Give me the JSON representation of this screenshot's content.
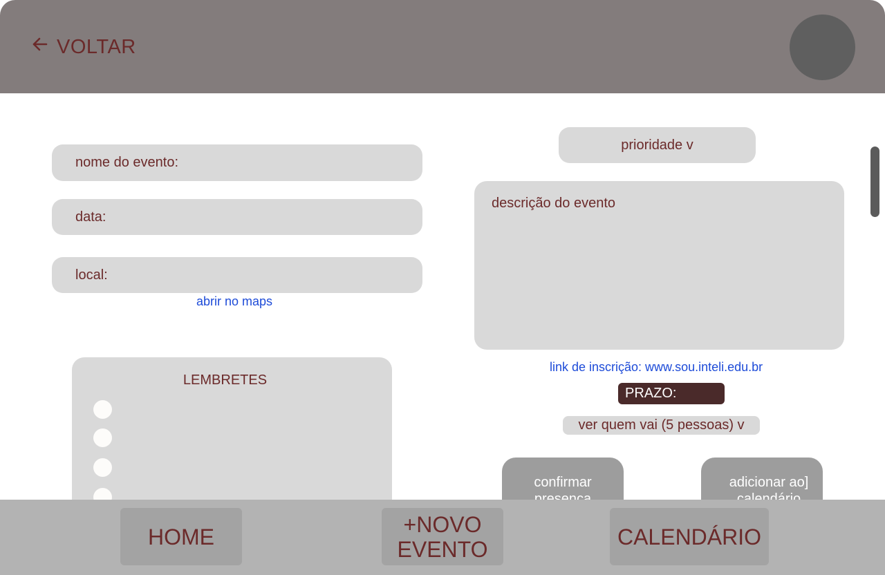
{
  "header": {
    "back_label": "VOLTAR",
    "back_icon": "arrow-left-icon",
    "avatar": "avatar"
  },
  "form": {
    "name_label": "nome do evento:",
    "date_label": "data:",
    "location_label": "local:",
    "maps_link": "abrir no maps"
  },
  "reminders": {
    "title": "LEMBRETES",
    "items": [
      "",
      "",
      "",
      ""
    ]
  },
  "details": {
    "priority_label": "prioridade v",
    "description_placeholder": "descrição do evento",
    "signup_link": "link de inscrição: www.sou.inteli.edu.br",
    "deadline_label": "PRAZO:",
    "attendees_label": "ver quem vai (5 pessoas) v",
    "confirm_button": "confirmar presença",
    "calendar_button": "adicionar ao] calendário"
  },
  "nav": {
    "home": "HOME",
    "new_event": "+NOVO EVENTO",
    "calendar": "CALENDÁRIO"
  },
  "colors": {
    "header_bg": "#837c7c",
    "text": "#6b2a2a",
    "link": "#1d4bd8",
    "field_bg": "#d9d9d9",
    "deadline_bg": "#4a2a2a",
    "nav_bg": "#b3b3b3"
  }
}
